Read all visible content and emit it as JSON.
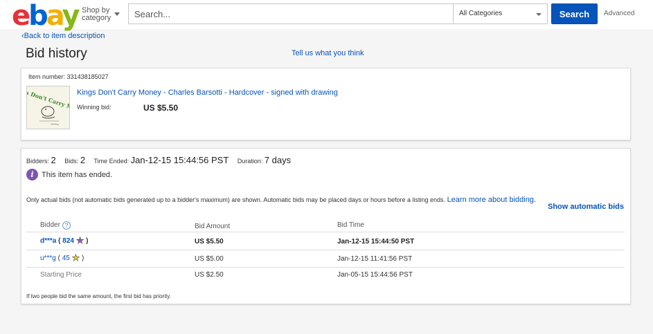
{
  "header": {
    "logo": {
      "e": "e",
      "b": "b",
      "a": "a",
      "y": "y"
    },
    "shop_by_line1": "Shop by",
    "shop_by_line2": "category",
    "search_placeholder": "Search...",
    "category_selected": "All Categories",
    "search_button": "Search",
    "advanced_link": "Advanced"
  },
  "nav": {
    "back_link": "Back to item description",
    "page_title": "Bid history",
    "feedback_link": "Tell us what you think"
  },
  "item": {
    "number_label": "Item number:",
    "number": "331438185027",
    "title": "Kings Don't Carry Money - Charles Barsotti - Hardcover - signed with drawing",
    "winning_label": "Winning bid:",
    "winning_value": "US $5.50",
    "thumbnail_text": "Kings Don't Carry Money"
  },
  "summary": {
    "bidders_label": "Bidders:",
    "bidders": "2",
    "bids_label": "Bids:",
    "bids": "2",
    "ended_label": "Time Ended:",
    "ended": "Jan-12-15 15:44:56 PST",
    "duration_label": "Duration:",
    "duration": "7 days",
    "ended_message": "This item has ended.",
    "note": "Only actual bids (not automatic bids generated up to a bidder's maximum) are shown. Automatic bids may be placed days or hours before a listing ends.",
    "learn_more": "Learn more about bidding.",
    "show_automatic": "Show automatic bids"
  },
  "table": {
    "headers": {
      "bidder": "Bidder",
      "amount": "Bid Amount",
      "time": "Bid Time"
    },
    "rows": [
      {
        "bidder": "d***a",
        "score": "824",
        "amount": "US $5.50",
        "time": "Jan-12-15 15:44:50 PST"
      },
      {
        "bidder": "u***g",
        "score": "45",
        "amount": "US $5.00",
        "time": "Jan-12-15 11:41:56 PST"
      },
      {
        "bidder": "Starting Price",
        "amount": "US $2.50",
        "time": "Jan-05-15 15:44:56 PST"
      }
    ],
    "star_colors": {
      "row0": "#9b59d0",
      "row1": "#f0d020"
    },
    "priority_note": "If two people bid the same amount, the first bid has priority."
  }
}
